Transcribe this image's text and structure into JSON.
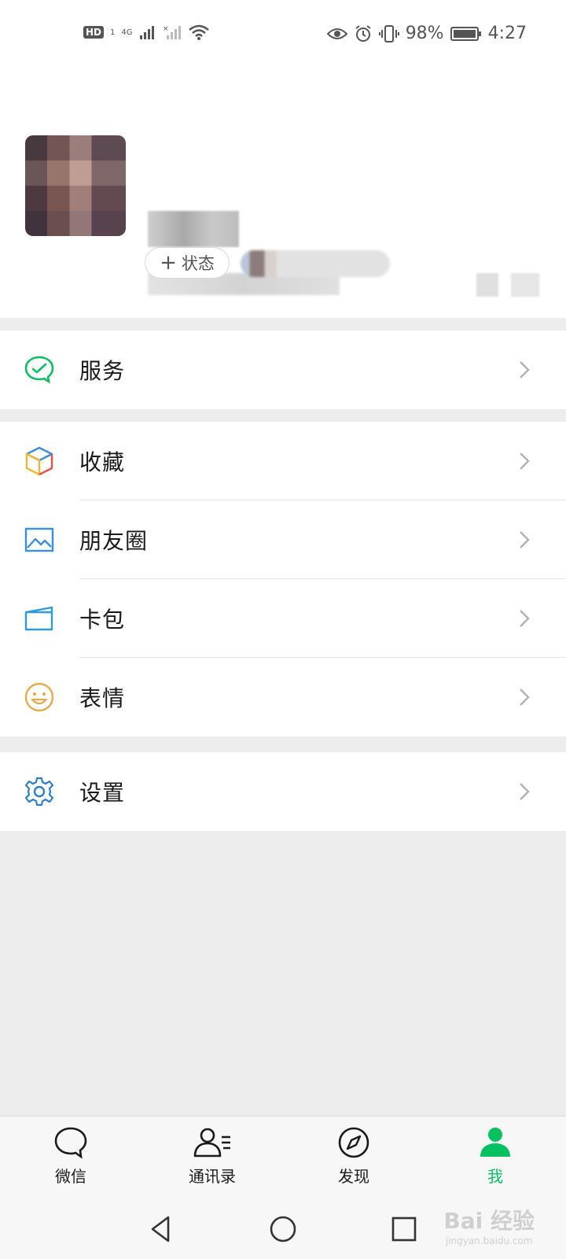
{
  "status_bar": {
    "hd": "HD",
    "sim": "1",
    "network": "4G",
    "battery_percent": "98%",
    "time": "4:27"
  },
  "profile": {
    "add_status_plus": "+",
    "add_status_label": "状态"
  },
  "menu": {
    "service": "服务",
    "favorites": "收藏",
    "moments": "朋友圈",
    "cards": "卡包",
    "stickers": "表情",
    "settings": "设置"
  },
  "tabs": [
    {
      "label": "微信",
      "icon": "chat-bubble-icon",
      "active": false
    },
    {
      "label": "通讯录",
      "icon": "contacts-icon",
      "active": false
    },
    {
      "label": "发现",
      "icon": "compass-icon",
      "active": false
    },
    {
      "label": "我",
      "icon": "person-icon",
      "active": true
    }
  ],
  "colors": {
    "accent": "#07c160",
    "background": "#ededed"
  },
  "watermark": {
    "brand": "Bai 经验",
    "url": "jingyan.baidu.com"
  }
}
